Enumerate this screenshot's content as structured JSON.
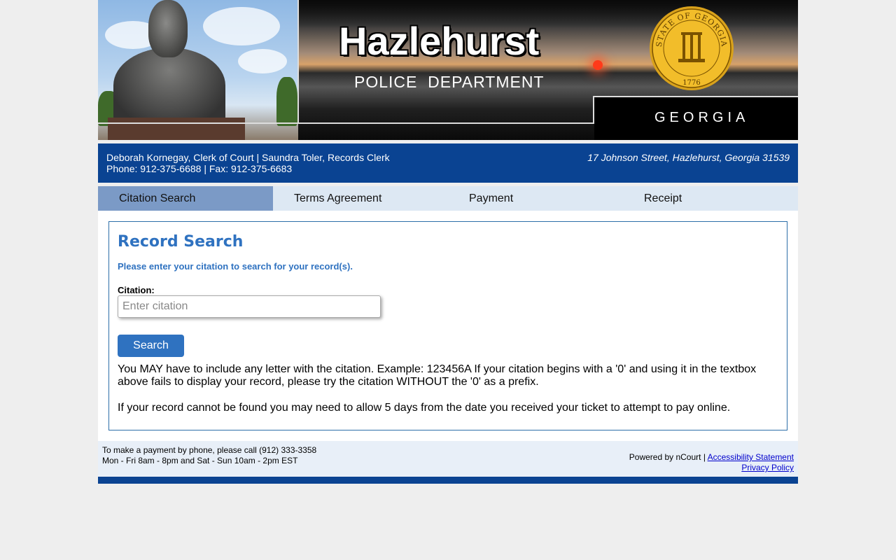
{
  "banner": {
    "title": "Hazlehurst",
    "subtitle": "POLICE  DEPARTMENT",
    "state": "GEORGIA",
    "seal_text": "STATE OF GEORGIA",
    "seal_year": "1776"
  },
  "infobar": {
    "line1": "Deborah Kornegay, Clerk of Court | Saundra Toler, Records Clerk",
    "line2": "Phone: 912-375-6688 | Fax: 912-375-6683",
    "address": "17 Johnson Street, Hazlehurst, Georgia 31539"
  },
  "steps": [
    {
      "label": "Citation Search",
      "active": true
    },
    {
      "label": "Terms Agreement",
      "active": false
    },
    {
      "label": "Payment",
      "active": false
    },
    {
      "label": "Receipt",
      "active": false
    }
  ],
  "record_search": {
    "heading": "Record Search",
    "instruction": "Please enter your citation to search for your record(s).",
    "citation_label": "Citation:",
    "citation_placeholder": "Enter citation",
    "citation_value": "",
    "search_label": "Search",
    "note1": "You MAY have to include any letter with the citation. Example: 123456A If your citation begins with a '0' and using it in the textbox above fails to display your record, please try the citation WITHOUT the '0' as a prefix.",
    "note2": "If your record cannot be found you may need to allow 5 days from the date you received your ticket to attempt to pay online."
  },
  "footer": {
    "phone_line": "To make a payment by phone, please call (912) 333-3358",
    "hours_line": "Mon - Fri 8am - 8pm and Sat - Sun 10am - 2pm EST",
    "powered_by": "Powered by nCourt |",
    "accessibility_label": "Accessibility Statement",
    "privacy_label": "Privacy Policy"
  },
  "colors": {
    "brand_blue": "#0a4392",
    "accent_blue": "#2f72c0",
    "step_active": "#7b9ac6",
    "step_inactive": "#dde8f3"
  }
}
